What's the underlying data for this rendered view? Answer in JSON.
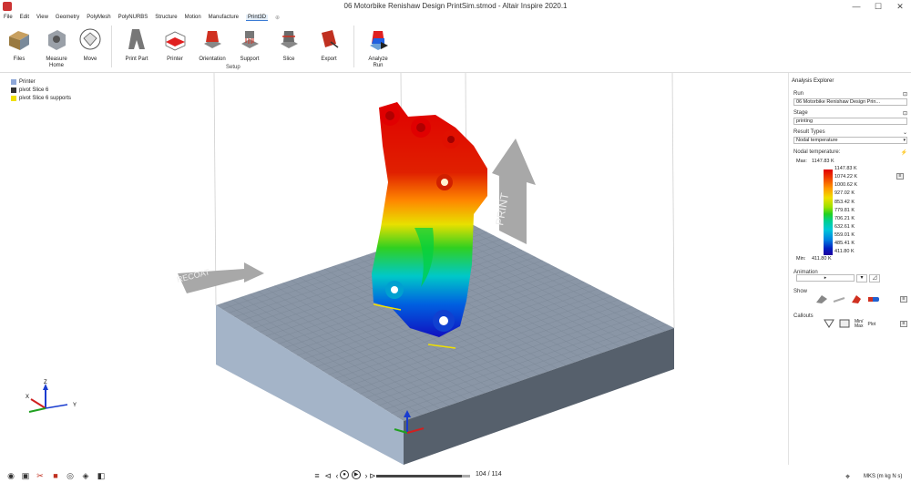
{
  "window": {
    "title": "06 Motorbike Renishaw Design PrintSim.stmod - Altair Inspire 2020.1",
    "controls": [
      "—",
      "☐",
      "✕"
    ]
  },
  "menu": {
    "items": [
      "File",
      "Edit",
      "View",
      "Geometry",
      "PolyMesh",
      "PolyNURBS",
      "Structure",
      "Motion",
      "Manufacture",
      "Print3D"
    ],
    "active": "Print3D"
  },
  "ribbon": {
    "tools": [
      {
        "label": "Files",
        "icon": "files-icon"
      },
      {
        "label": "Measure\nHome",
        "icon": "measure-home-icon"
      },
      {
        "label": "Move",
        "icon": "move-icon"
      },
      {
        "label": "Print Part",
        "icon": "print-part-icon"
      },
      {
        "label": "Printer",
        "icon": "printer-icon"
      },
      {
        "label": "Orientation",
        "icon": "orientation-icon"
      },
      {
        "label": "Support",
        "icon": "support-icon"
      },
      {
        "label": "Slice",
        "icon": "slice-icon"
      },
      {
        "label": "Export",
        "icon": "export-icon"
      },
      {
        "label": "Analyze\nRun",
        "icon": "analyze-run-icon"
      }
    ],
    "group_label": "Setup"
  },
  "browser": {
    "items": [
      {
        "label": "Printer",
        "color": "#8fa8d8"
      },
      {
        "label": "pivot Slice 6",
        "color": "#333333"
      },
      {
        "label": "pivot Slice 6 supports",
        "color": "#f0e000"
      }
    ]
  },
  "viewport": {
    "recoat_label": "RECOAT",
    "print_label": "PRINT",
    "triad_top": {
      "x": "X",
      "y": "Y",
      "z": "Z"
    }
  },
  "panel": {
    "title": "Analysis Explorer",
    "run_label": "Run",
    "run_value": "06 Motorbike Renishaw Design Prin...",
    "stage_label": "Stage",
    "stage_value": "printing",
    "result_types_label": "Result Types",
    "result_value": "Nodal temperature",
    "legend_title": "Nodal temperature:",
    "max_label": "Max:",
    "max_value": "1147.83 K",
    "min_label": "Min:",
    "min_value": "411.80 K",
    "legend_values": [
      "1147.83 K",
      "1074.22 K",
      "1000.62 K",
      "927.02 K",
      "853.42 K",
      "779.81 K",
      "706.21 K",
      "632.61 K",
      "559.01 K",
      "485.41 K",
      "411.80 K"
    ],
    "animation_label": "Animation",
    "show_label": "Show",
    "callouts_label": "Callouts",
    "minmax_label": "Min/\nMax",
    "plot_label": "Plot"
  },
  "playback": {
    "frame": "104 / 114",
    "progress": 0.912
  },
  "status": {
    "units": "MKS (m kg N s)"
  }
}
